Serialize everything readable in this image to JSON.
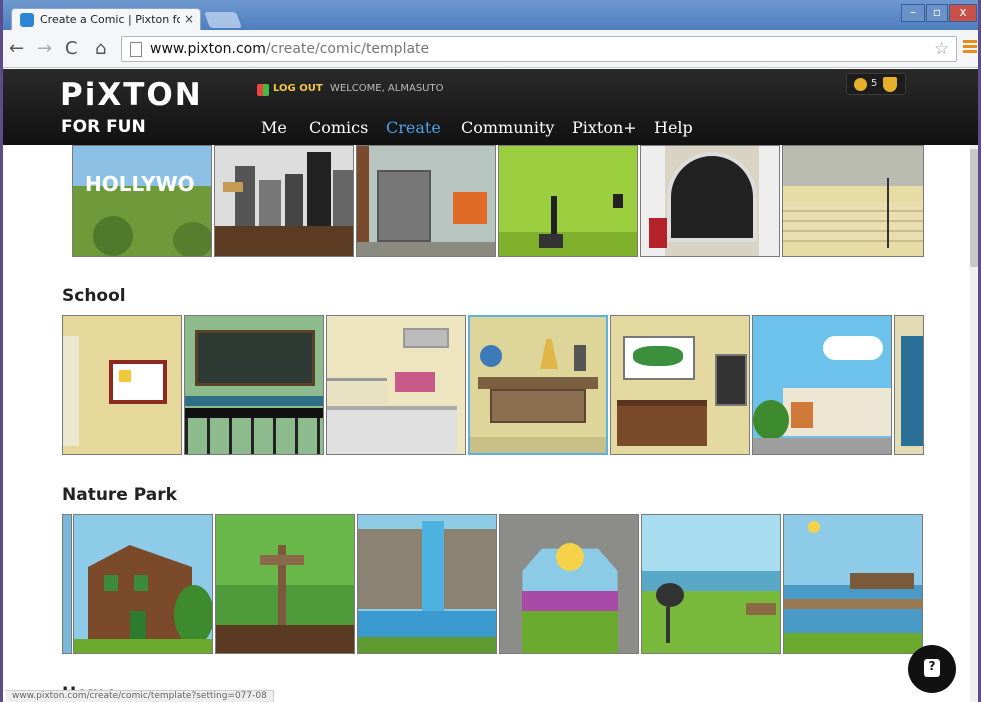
{
  "browser": {
    "tab_title": "Create a Comic | Pixton fo",
    "tab_close": "×",
    "url_host": "www.pixton.com",
    "url_path": "/create/comic/template",
    "controls": {
      "minimize": "–",
      "maximize": "▫",
      "close": "x"
    },
    "icons": [
      "back-icon",
      "forward-icon",
      "reload-icon",
      "home-icon",
      "star-icon",
      "menu-icon"
    ]
  },
  "site": {
    "logo": "PiXTON",
    "logo_sub": "FOR FUN",
    "logout": "LOG OUT",
    "welcome": "WELCOME, ALMASUTO",
    "coins": "5",
    "nav": [
      "Me",
      "Comics",
      "Create",
      "Community",
      "Pixton+",
      "Help"
    ],
    "active_nav": "Create",
    "colors": {
      "header": "#1a1a1a",
      "active": "#4aa3e8",
      "logout": "#f4c542"
    }
  },
  "sections": [
    {
      "title": "",
      "scenes": [
        "Hollywood sign",
        "Film set city",
        "Wardrobe room",
        "Green screen studio",
        "Theater lobby",
        "Stage with mic"
      ]
    },
    {
      "title": "School",
      "scenes": [
        "Classroom bulletin board",
        "Cafeteria tables",
        "Cafeteria counter",
        "Science lab desk",
        "Teacher desk with map",
        "School exterior",
        "Lockers"
      ]
    },
    {
      "title": "Nature Park",
      "scenes": [
        "Log cabin",
        "Forest signpost",
        "Waterfall",
        "Stone bridge",
        "Barbecue grill",
        "Lake dock"
      ]
    },
    {
      "title": "Home",
      "scenes": []
    }
  ],
  "status_bar": "www.pixton.com/create/comic/template?setting=077-08",
  "help": "?"
}
